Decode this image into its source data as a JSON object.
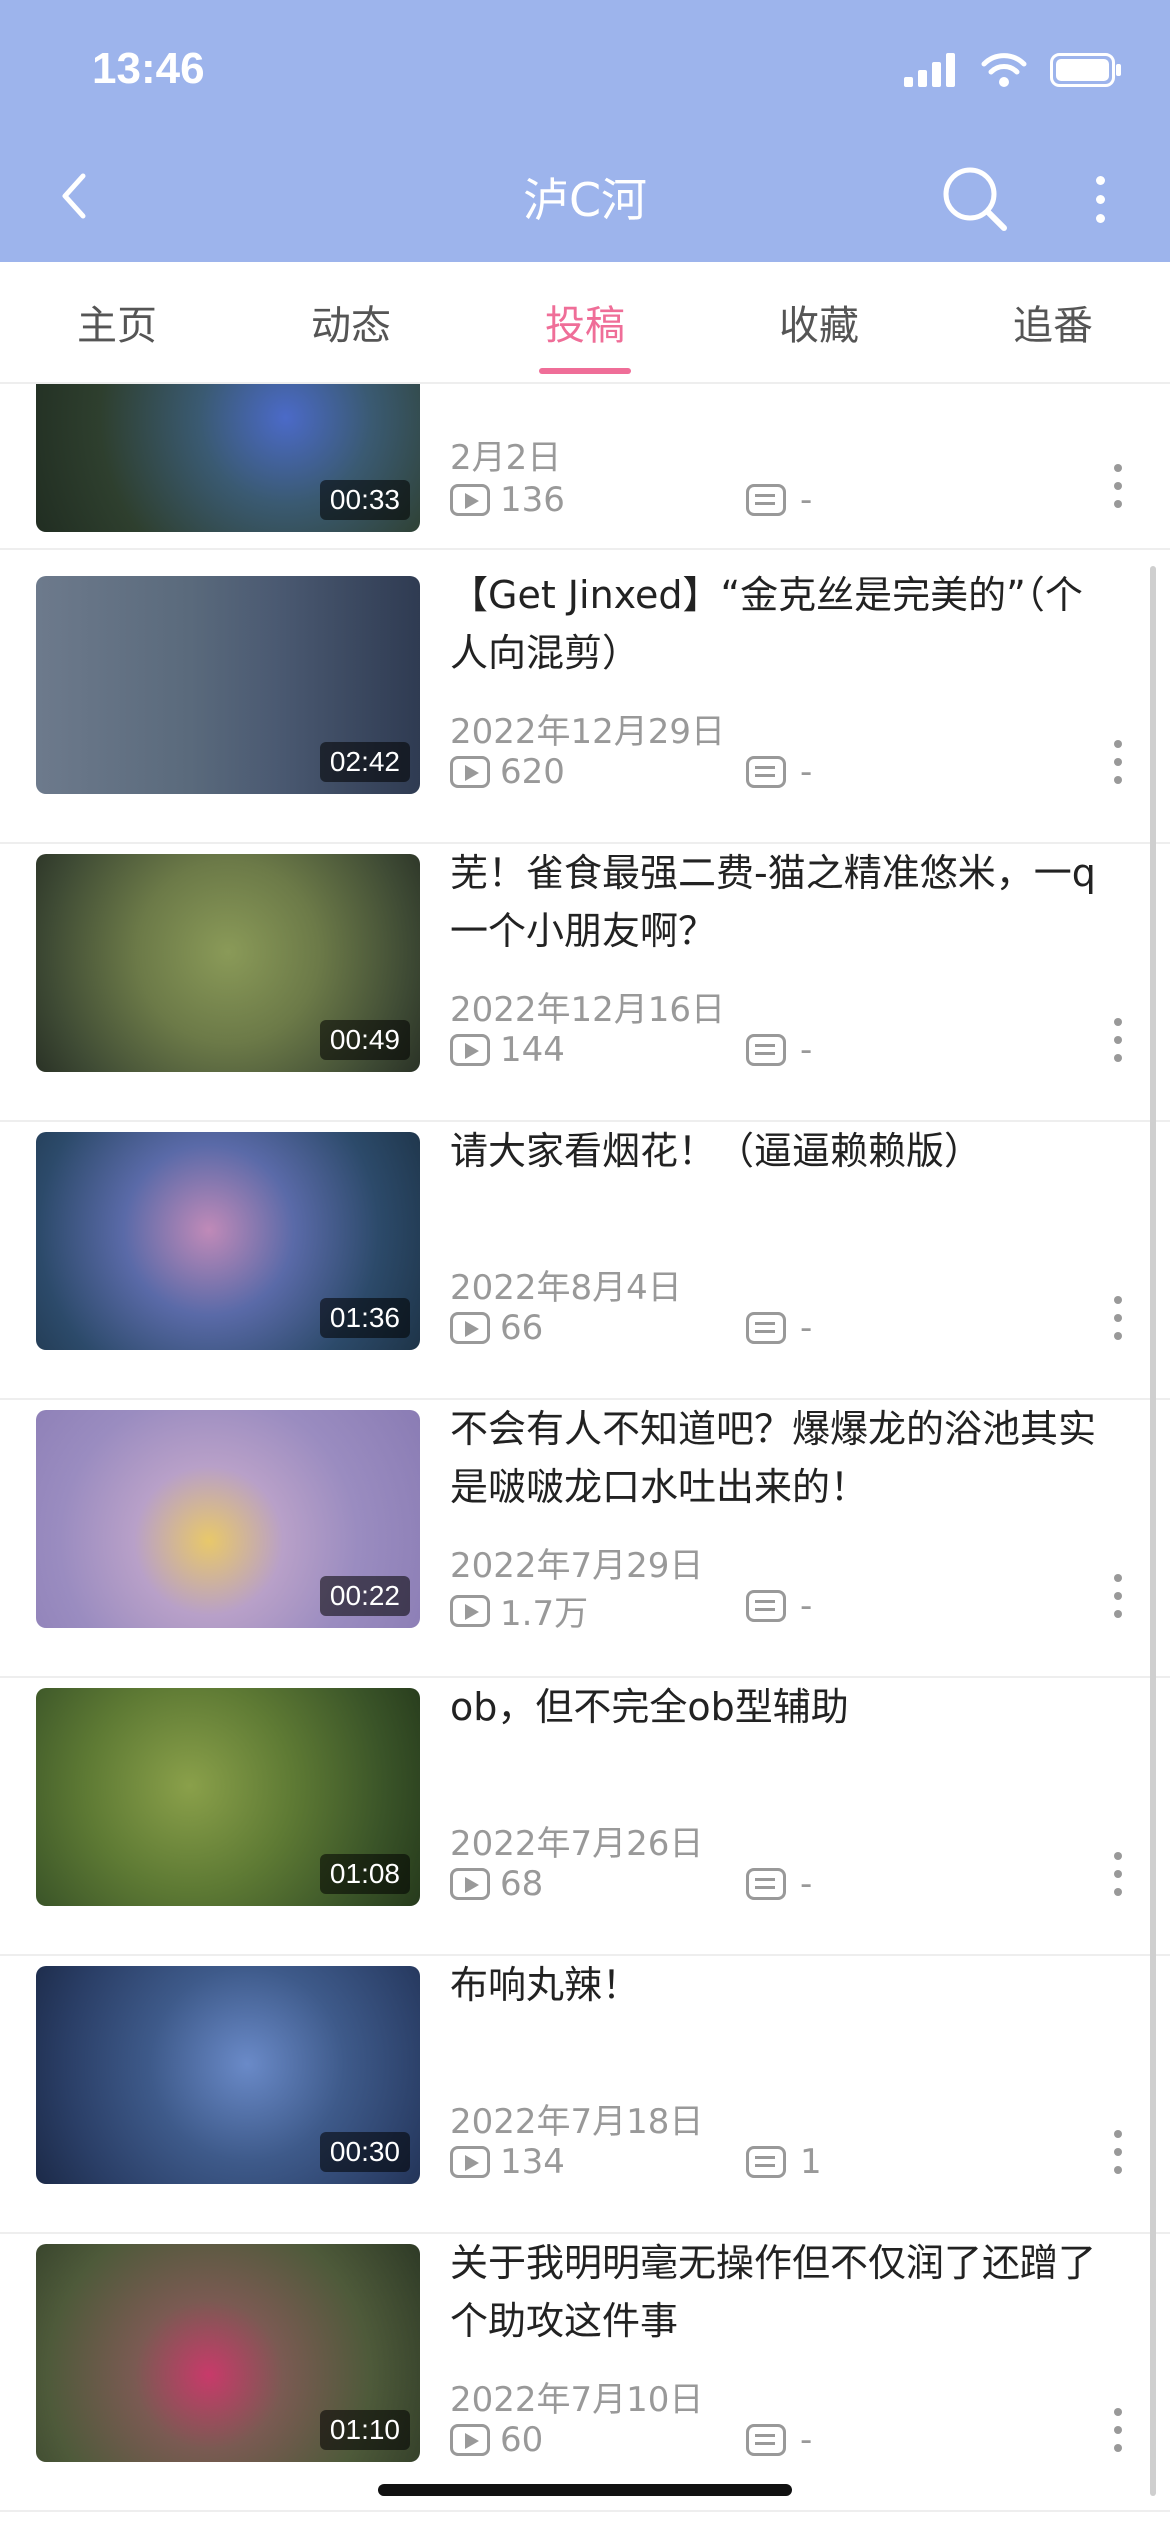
{
  "status_bar": {
    "time": "13:46"
  },
  "nav": {
    "title": "泸C河"
  },
  "tabs": [
    {
      "label": "主页",
      "active": false
    },
    {
      "label": "动态",
      "active": false
    },
    {
      "label": "投稿",
      "active": true
    },
    {
      "label": "收藏",
      "active": false
    },
    {
      "label": "追番",
      "active": false
    }
  ],
  "accent_color": "#ef6e98",
  "header_color": "#9db4ec",
  "videos": [
    {
      "title": "",
      "date": "2月2日",
      "plays": "136",
      "danmaku": "-",
      "duration": "00:33"
    },
    {
      "title": "【Get Jinxed】“金克丝是完美的”（个人向混剪）",
      "date": "2022年12月29日",
      "plays": "620",
      "danmaku": "-",
      "duration": "02:42"
    },
    {
      "title": "芜！雀食最强二费-猫之精准悠米，一q一个小朋友啊？",
      "date": "2022年12月16日",
      "plays": "144",
      "danmaku": "-",
      "duration": "00:49"
    },
    {
      "title": "请大家看烟花！（逼逼赖赖版）",
      "date": "2022年8月4日",
      "plays": "66",
      "danmaku": "-",
      "duration": "01:36"
    },
    {
      "title": "不会有人不知道吧？爆爆龙的浴池其实是啵啵龙口水吐出来的！",
      "date": "2022年7月29日",
      "plays": "1.7万",
      "danmaku": "-",
      "duration": "00:22"
    },
    {
      "title": "ob，但不完全ob型辅助",
      "date": "2022年7月26日",
      "plays": "68",
      "danmaku": "-",
      "duration": "01:08"
    },
    {
      "title": "布响丸辣！",
      "date": "2022年7月18日",
      "plays": "134",
      "danmaku": "1",
      "duration": "00:30"
    },
    {
      "title": "关于我明明毫无操作但不仅润了还蹭了个助攻这件事",
      "date": "2022年7月10日",
      "plays": "60",
      "danmaku": "-",
      "duration": "01:10"
    }
  ]
}
